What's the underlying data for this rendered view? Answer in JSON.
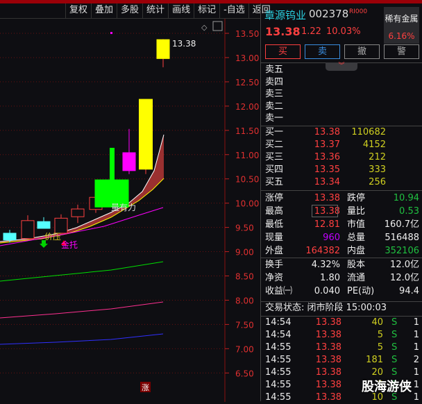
{
  "toolbar": [
    "复权",
    "叠加",
    "多股",
    "统计",
    "画线",
    "标记",
    "-自选",
    "返回"
  ],
  "chart": {
    "yticks": [
      "13.50",
      "13.00",
      "12.50",
      "12.00",
      "11.50",
      "11.00",
      "10.50",
      "10.00",
      "9.50",
      "9.00",
      "8.50",
      "8.00",
      "7.50",
      "7.00",
      "6.50"
    ],
    "last_label": "13.38",
    "annotations": {
      "price_pressure": "价压",
      "money_support": "金托",
      "volume_strong": "量有力",
      "limit_up_marker": "涨"
    },
    "candles": [
      {
        "o": 9.24,
        "c": 9.38,
        "h": 9.45,
        "l": 9.19,
        "color": "#55ffff",
        "fill": true
      },
      {
        "o": 9.27,
        "c": 9.64,
        "h": 9.75,
        "l": 9.27,
        "color": "#ff4040",
        "fill": false
      },
      {
        "o": 9.48,
        "c": 9.62,
        "h": 9.71,
        "l": 9.48,
        "color": "#55ffff",
        "fill": true
      },
      {
        "o": 9.38,
        "c": 9.69,
        "h": 9.77,
        "l": 9.38,
        "color": "#ff4040",
        "fill": false
      },
      {
        "o": 9.72,
        "c": 9.88,
        "h": 9.97,
        "l": 9.59,
        "color": "#ff4040",
        "fill": false
      },
      {
        "o": 9.87,
        "c": 10.12,
        "h": 10.2,
        "l": 9.8,
        "color": "#ff4040",
        "fill": false
      },
      {
        "o": 9.92,
        "c": 10.48,
        "h": 11.14,
        "l": 9.92,
        "color": "#00ff00",
        "fill": true
      },
      {
        "o": 10.67,
        "c": 11.04,
        "h": 11.53,
        "l": 10.6,
        "color": "#ff00ff",
        "fill": true
      },
      {
        "o": 10.7,
        "c": 12.14,
        "h": 12.14,
        "l": 10.6,
        "color": "#ffff00",
        "fill": true
      },
      {
        "o": 12.98,
        "c": 13.37,
        "h": 13.38,
        "l": 12.8,
        "color": "#ffff00",
        "fill": true
      }
    ]
  },
  "stock": {
    "name": "章源钨业",
    "code": "002378",
    "tag": "RI000",
    "sector": "稀有金属",
    "sector_pct": "6.16%",
    "price": "13.38",
    "change": "1.22",
    "pct": "10.03%"
  },
  "actions": [
    "买",
    "卖",
    "撤",
    "警"
  ],
  "asks": [
    "卖五",
    "卖四",
    "卖三",
    "卖二",
    "卖一"
  ],
  "bids": [
    [
      "买一",
      "13.38",
      "110682"
    ],
    [
      "买二",
      "13.37",
      "4152"
    ],
    [
      "买三",
      "13.36",
      "212"
    ],
    [
      "买四",
      "13.35",
      "333"
    ],
    [
      "买五",
      "13.34",
      "256"
    ]
  ],
  "stats": [
    [
      "涨停",
      "13.38",
      "跌停",
      "10.94"
    ],
    [
      "最高",
      "13.38",
      "量比",
      "0.53"
    ],
    [
      "最低",
      "12.81",
      "市值",
      "160.7亿"
    ],
    [
      "现量",
      "960",
      "总量",
      "516488"
    ],
    [
      "外盘",
      "164382",
      "内盘",
      "352106"
    ]
  ],
  "stats2": [
    [
      "换手",
      "4.32%",
      "股本",
      "12.0亿"
    ],
    [
      "净资",
      "1.80",
      "流通",
      "12.0亿"
    ],
    [
      "收益㈠",
      "0.040",
      "PE(动)",
      "94.4"
    ]
  ],
  "status": "交易状态: 闭市阶段 15:00:03",
  "ticks": [
    [
      "14:54",
      "13.38",
      "40",
      "S",
      "1"
    ],
    [
      "14:54",
      "13.38",
      "5",
      "S",
      "1"
    ],
    [
      "14:55",
      "13.38",
      "5",
      "S",
      "1"
    ],
    [
      "14:55",
      "13.38",
      "181",
      "S",
      "2"
    ],
    [
      "14:55",
      "13.38",
      "20",
      "S",
      "1"
    ],
    [
      "14:55",
      "13.38",
      "5",
      "S",
      "1"
    ],
    [
      "14:55",
      "13.38",
      "10",
      "S",
      "1"
    ]
  ],
  "watermark": "股海游侠"
}
